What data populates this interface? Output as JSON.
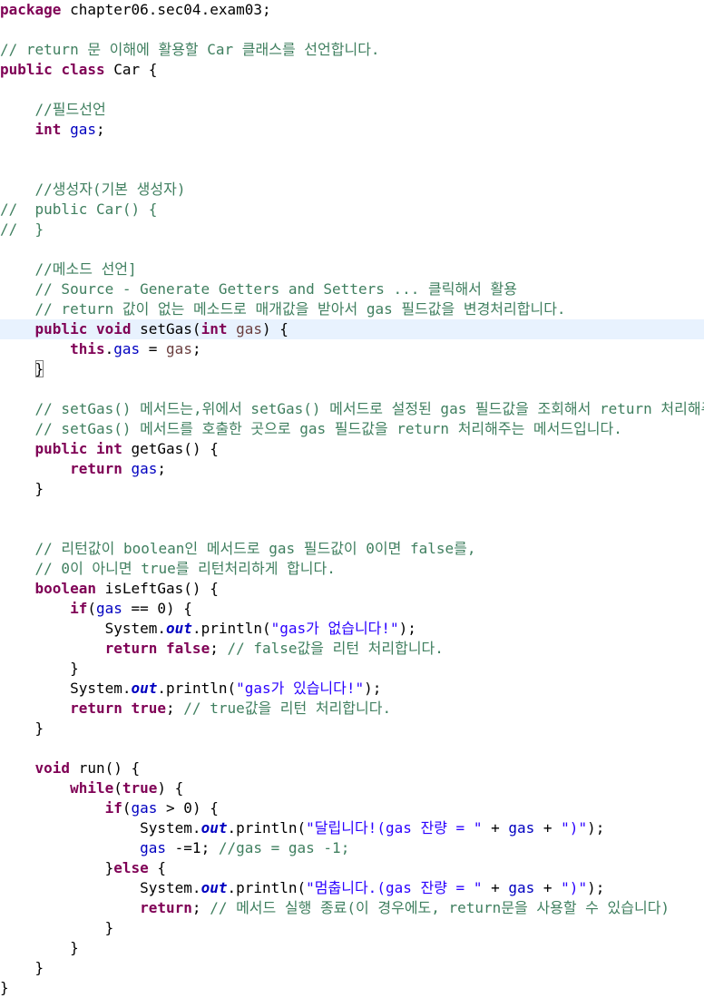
{
  "editor": {
    "language": "java",
    "current_line_index": 16,
    "colors": {
      "background": "#ffffff",
      "current_line": "#e8f2fe",
      "keyword": "#7f0055",
      "comment": "#3f7f5f",
      "field": "#0000c0",
      "string": "#2a00ff",
      "variable": "#6a3e3e",
      "plain": "#000000"
    },
    "lines": [
      [
        {
          "t": "kw",
          "v": "package"
        },
        {
          "t": "pl",
          "v": " chapter06.sec04.exam03;"
        }
      ],
      [],
      [
        {
          "t": "cm",
          "v": "// return 문 이해에 활용할 Car 클래스를 선언합니다."
        }
      ],
      [
        {
          "t": "kw",
          "v": "public"
        },
        {
          "t": "pl",
          "v": " "
        },
        {
          "t": "kw",
          "v": "class"
        },
        {
          "t": "pl",
          "v": " Car {"
        }
      ],
      [],
      [
        {
          "t": "pl",
          "v": "    "
        },
        {
          "t": "cm",
          "v": "//필드선언"
        }
      ],
      [
        {
          "t": "pl",
          "v": "    "
        },
        {
          "t": "kw",
          "v": "int"
        },
        {
          "t": "pl",
          "v": " "
        },
        {
          "t": "fd",
          "v": "gas"
        },
        {
          "t": "pl",
          "v": ";"
        }
      ],
      [],
      [],
      [
        {
          "t": "pl",
          "v": "    "
        },
        {
          "t": "cm",
          "v": "//생성자(기본 생성자)"
        }
      ],
      [
        {
          "t": "cm",
          "v": "//  public Car() {"
        }
      ],
      [
        {
          "t": "cm",
          "v": "//  }"
        }
      ],
      [],
      [
        {
          "t": "pl",
          "v": "    "
        },
        {
          "t": "cm",
          "v": "//메소드 선언]"
        }
      ],
      [
        {
          "t": "pl",
          "v": "    "
        },
        {
          "t": "cm",
          "v": "// Source - Generate Getters and Setters ... 클릭해서 활용"
        }
      ],
      [
        {
          "t": "pl",
          "v": "    "
        },
        {
          "t": "cm",
          "v": "// return 값이 없는 메소드로 매개값을 받아서 gas 필드값을 변경처리합니다."
        }
      ],
      [
        {
          "t": "pl",
          "v": "    "
        },
        {
          "t": "kw",
          "v": "public"
        },
        {
          "t": "pl",
          "v": " "
        },
        {
          "t": "kw",
          "v": "void"
        },
        {
          "t": "pl",
          "v": " setGas("
        },
        {
          "t": "kw",
          "v": "int"
        },
        {
          "t": "pl",
          "v": " "
        },
        {
          "t": "vr",
          "v": "gas"
        },
        {
          "t": "pl",
          "v": ") {"
        }
      ],
      [
        {
          "t": "pl",
          "v": "        "
        },
        {
          "t": "kw",
          "v": "this"
        },
        {
          "t": "pl",
          "v": "."
        },
        {
          "t": "fd",
          "v": "gas"
        },
        {
          "t": "pl",
          "v": " = "
        },
        {
          "t": "vr",
          "v": "gas"
        },
        {
          "t": "pl",
          "v": ";"
        }
      ],
      [
        {
          "t": "pl",
          "v": "    "
        },
        {
          "t": "br",
          "v": "}"
        }
      ],
      [],
      [
        {
          "t": "pl",
          "v": "    "
        },
        {
          "t": "cm",
          "v": "// setGas() 메서드는,위에서 setGas() 메서드로 설정된 gas 필드값을 조회해서 return 처리해주는"
        }
      ],
      [
        {
          "t": "pl",
          "v": "    "
        },
        {
          "t": "cm",
          "v": "// setGas() 메서드를 호출한 곳으로 gas 필드값을 return 처리해주는 메서드입니다."
        }
      ],
      [
        {
          "t": "pl",
          "v": "    "
        },
        {
          "t": "kw",
          "v": "public"
        },
        {
          "t": "pl",
          "v": " "
        },
        {
          "t": "kw",
          "v": "int"
        },
        {
          "t": "pl",
          "v": " getGas() {"
        }
      ],
      [
        {
          "t": "pl",
          "v": "        "
        },
        {
          "t": "kw",
          "v": "return"
        },
        {
          "t": "pl",
          "v": " "
        },
        {
          "t": "fd",
          "v": "gas"
        },
        {
          "t": "pl",
          "v": ";"
        }
      ],
      [
        {
          "t": "pl",
          "v": "    }"
        }
      ],
      [],
      [],
      [
        {
          "t": "pl",
          "v": "    "
        },
        {
          "t": "cm",
          "v": "// 리턴값이 boolean인 메서드로 gas 필드값이 0이면 false를,"
        }
      ],
      [
        {
          "t": "pl",
          "v": "    "
        },
        {
          "t": "cm",
          "v": "// 0이 아니면 true를 리턴처리하게 합니다."
        }
      ],
      [
        {
          "t": "pl",
          "v": "    "
        },
        {
          "t": "kw",
          "v": "boolean"
        },
        {
          "t": "pl",
          "v": " isLeftGas() {"
        }
      ],
      [
        {
          "t": "pl",
          "v": "        "
        },
        {
          "t": "kw",
          "v": "if"
        },
        {
          "t": "pl",
          "v": "("
        },
        {
          "t": "fd",
          "v": "gas"
        },
        {
          "t": "pl",
          "v": " == 0) {"
        }
      ],
      [
        {
          "t": "pl",
          "v": "            System."
        },
        {
          "t": "si",
          "v": "out"
        },
        {
          "t": "pl",
          "v": ".println("
        },
        {
          "t": "st",
          "v": "\"gas가 없습니다!\""
        },
        {
          "t": "pl",
          "v": ");"
        }
      ],
      [
        {
          "t": "pl",
          "v": "            "
        },
        {
          "t": "kw",
          "v": "return"
        },
        {
          "t": "pl",
          "v": " "
        },
        {
          "t": "kw",
          "v": "false"
        },
        {
          "t": "pl",
          "v": "; "
        },
        {
          "t": "cm",
          "v": "// false값을 리턴 처리합니다."
        }
      ],
      [
        {
          "t": "pl",
          "v": "        }"
        }
      ],
      [
        {
          "t": "pl",
          "v": "        System."
        },
        {
          "t": "si",
          "v": "out"
        },
        {
          "t": "pl",
          "v": ".println("
        },
        {
          "t": "st",
          "v": "\"gas가 있습니다!\""
        },
        {
          "t": "pl",
          "v": ");"
        }
      ],
      [
        {
          "t": "pl",
          "v": "        "
        },
        {
          "t": "kw",
          "v": "return"
        },
        {
          "t": "pl",
          "v": " "
        },
        {
          "t": "kw",
          "v": "true"
        },
        {
          "t": "pl",
          "v": "; "
        },
        {
          "t": "cm",
          "v": "// true값을 리턴 처리합니다."
        }
      ],
      [
        {
          "t": "pl",
          "v": "    }"
        }
      ],
      [],
      [
        {
          "t": "pl",
          "v": "    "
        },
        {
          "t": "kw",
          "v": "void"
        },
        {
          "t": "pl",
          "v": " run() {"
        }
      ],
      [
        {
          "t": "pl",
          "v": "        "
        },
        {
          "t": "kw",
          "v": "while"
        },
        {
          "t": "pl",
          "v": "("
        },
        {
          "t": "kw",
          "v": "true"
        },
        {
          "t": "pl",
          "v": ") {"
        }
      ],
      [
        {
          "t": "pl",
          "v": "            "
        },
        {
          "t": "kw",
          "v": "if"
        },
        {
          "t": "pl",
          "v": "("
        },
        {
          "t": "fd",
          "v": "gas"
        },
        {
          "t": "pl",
          "v": " > 0) {"
        }
      ],
      [
        {
          "t": "pl",
          "v": "                System."
        },
        {
          "t": "si",
          "v": "out"
        },
        {
          "t": "pl",
          "v": ".println("
        },
        {
          "t": "st",
          "v": "\"달립니다!(gas 잔량 = \""
        },
        {
          "t": "pl",
          "v": " + "
        },
        {
          "t": "fd",
          "v": "gas"
        },
        {
          "t": "pl",
          "v": " + "
        },
        {
          "t": "st",
          "v": "\")\""
        },
        {
          "t": "pl",
          "v": ");"
        }
      ],
      [
        {
          "t": "pl",
          "v": "                "
        },
        {
          "t": "fd",
          "v": "gas"
        },
        {
          "t": "pl",
          "v": " -=1; "
        },
        {
          "t": "cm",
          "v": "//gas = gas -1;"
        }
      ],
      [
        {
          "t": "pl",
          "v": "            }"
        },
        {
          "t": "kw",
          "v": "else"
        },
        {
          "t": "pl",
          "v": " {"
        }
      ],
      [
        {
          "t": "pl",
          "v": "                System."
        },
        {
          "t": "si",
          "v": "out"
        },
        {
          "t": "pl",
          "v": ".println("
        },
        {
          "t": "st",
          "v": "\"멈춥니다.(gas 잔량 = \""
        },
        {
          "t": "pl",
          "v": " + "
        },
        {
          "t": "fd",
          "v": "gas"
        },
        {
          "t": "pl",
          "v": " + "
        },
        {
          "t": "st",
          "v": "\")\""
        },
        {
          "t": "pl",
          "v": ");"
        }
      ],
      [
        {
          "t": "pl",
          "v": "                "
        },
        {
          "t": "kw",
          "v": "return"
        },
        {
          "t": "pl",
          "v": "; "
        },
        {
          "t": "cm",
          "v": "// 메서드 실행 종료(이 경우에도, return문을 사용할 수 있습니다)"
        }
      ],
      [
        {
          "t": "pl",
          "v": "            }"
        }
      ],
      [
        {
          "t": "pl",
          "v": "        }"
        }
      ],
      [
        {
          "t": "pl",
          "v": "    }"
        }
      ],
      [
        {
          "t": "pl",
          "v": "}"
        }
      ]
    ]
  }
}
